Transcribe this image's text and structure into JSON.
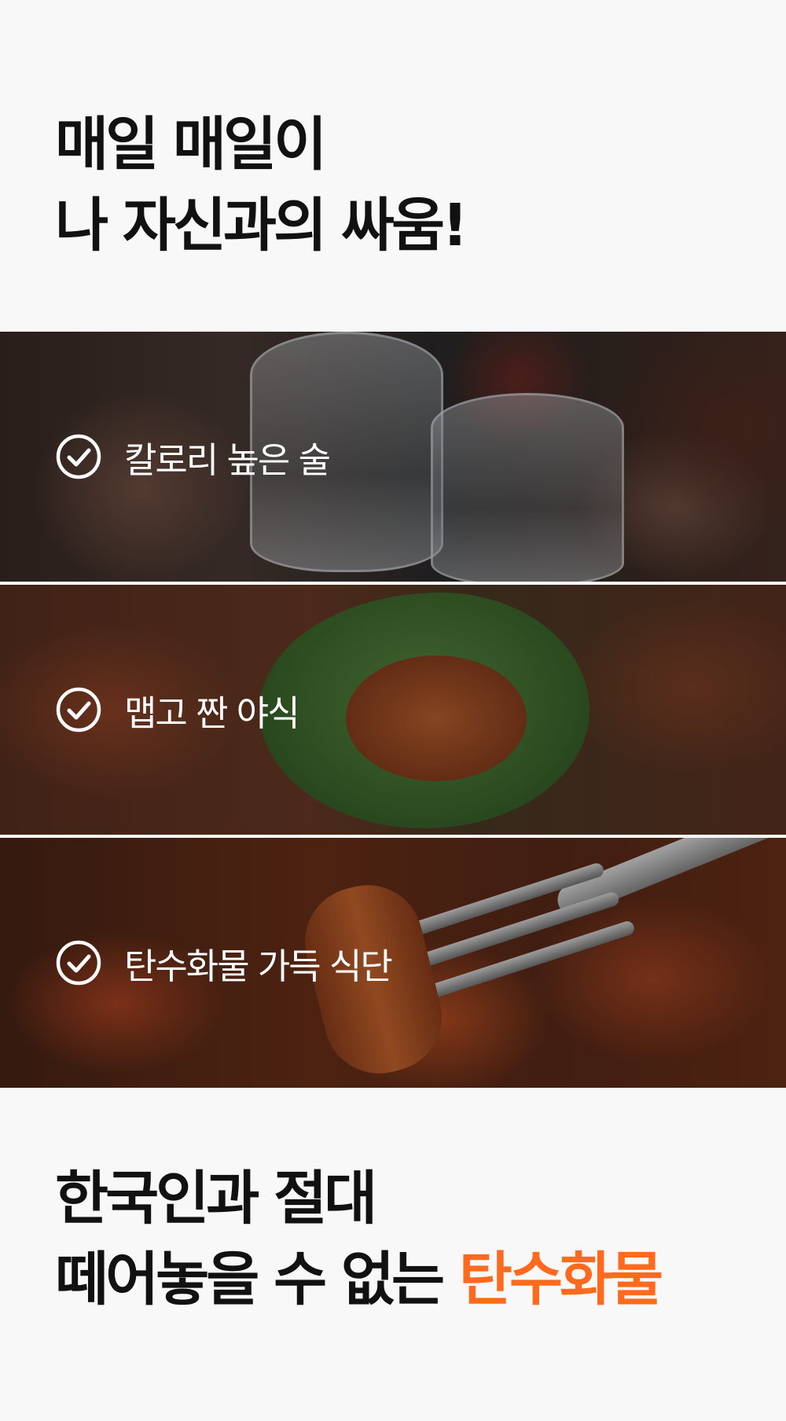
{
  "intro": {
    "line1": "매일 매일이",
    "line2": "나 자신과의 싸움!"
  },
  "banners": [
    {
      "label": "칼로리 높은 술",
      "icon": "check-circle-icon"
    },
    {
      "label": "맵고 짠 야식",
      "icon": "check-circle-icon"
    },
    {
      "label": "탄수화물 가득 식단",
      "icon": "check-circle-icon"
    }
  ],
  "outro": {
    "line1": "한국인과 절대",
    "line2_prefix": "떼어놓을 수 없는 ",
    "line2_highlight": "탄수화물"
  },
  "colors": {
    "accent": "#ff6a1f",
    "text": "#111111",
    "background": "#f8f8f8"
  }
}
